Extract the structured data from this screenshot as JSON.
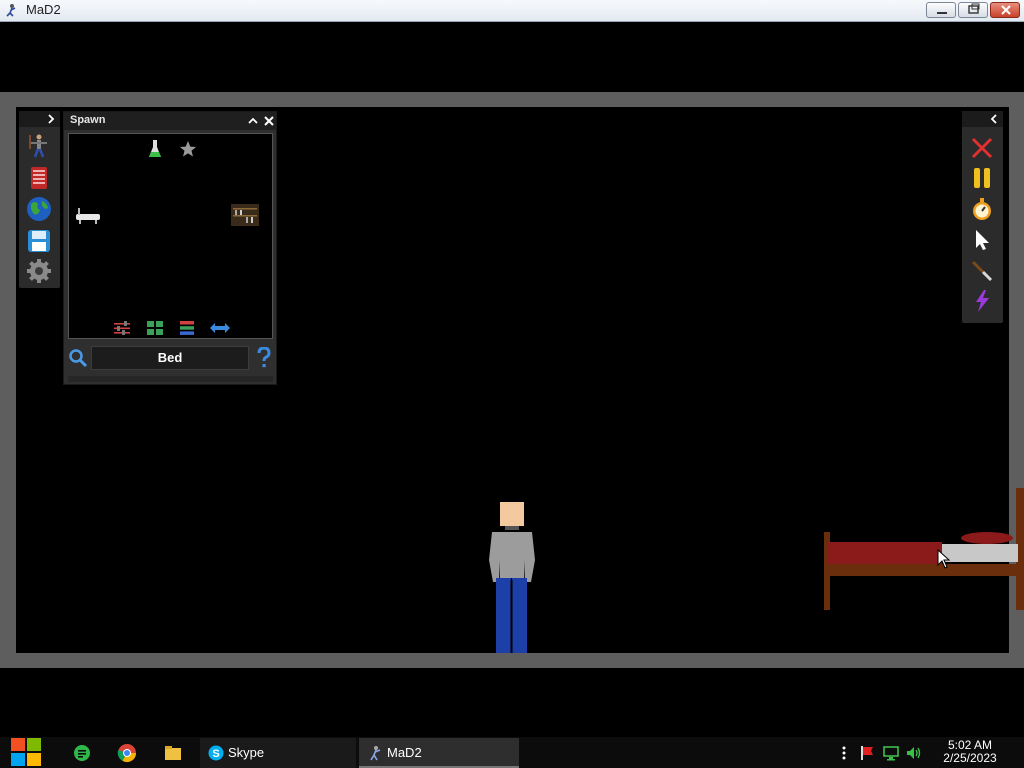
{
  "window": {
    "title": "MaD2"
  },
  "spawn_panel": {
    "title": "Spawn",
    "search_value": "Bed"
  },
  "taskbar": {
    "apps": [
      {
        "label": "Skype"
      },
      {
        "label": "MaD2"
      }
    ],
    "clock": {
      "time": "5:02 AM",
      "date": "2/25/2023"
    }
  },
  "colors": {
    "stage_background": "#000000",
    "frame_gray": "#5e5e5e",
    "panel_dark": "#2f2f2f",
    "bed_frame": "#6b2e0c",
    "bed_sheet": "#8b1a1a",
    "ragdoll_shirt": "#9c9c9c",
    "ragdoll_pants": "#1d3fa8",
    "ragdoll_skin": "#f5c9a0"
  }
}
